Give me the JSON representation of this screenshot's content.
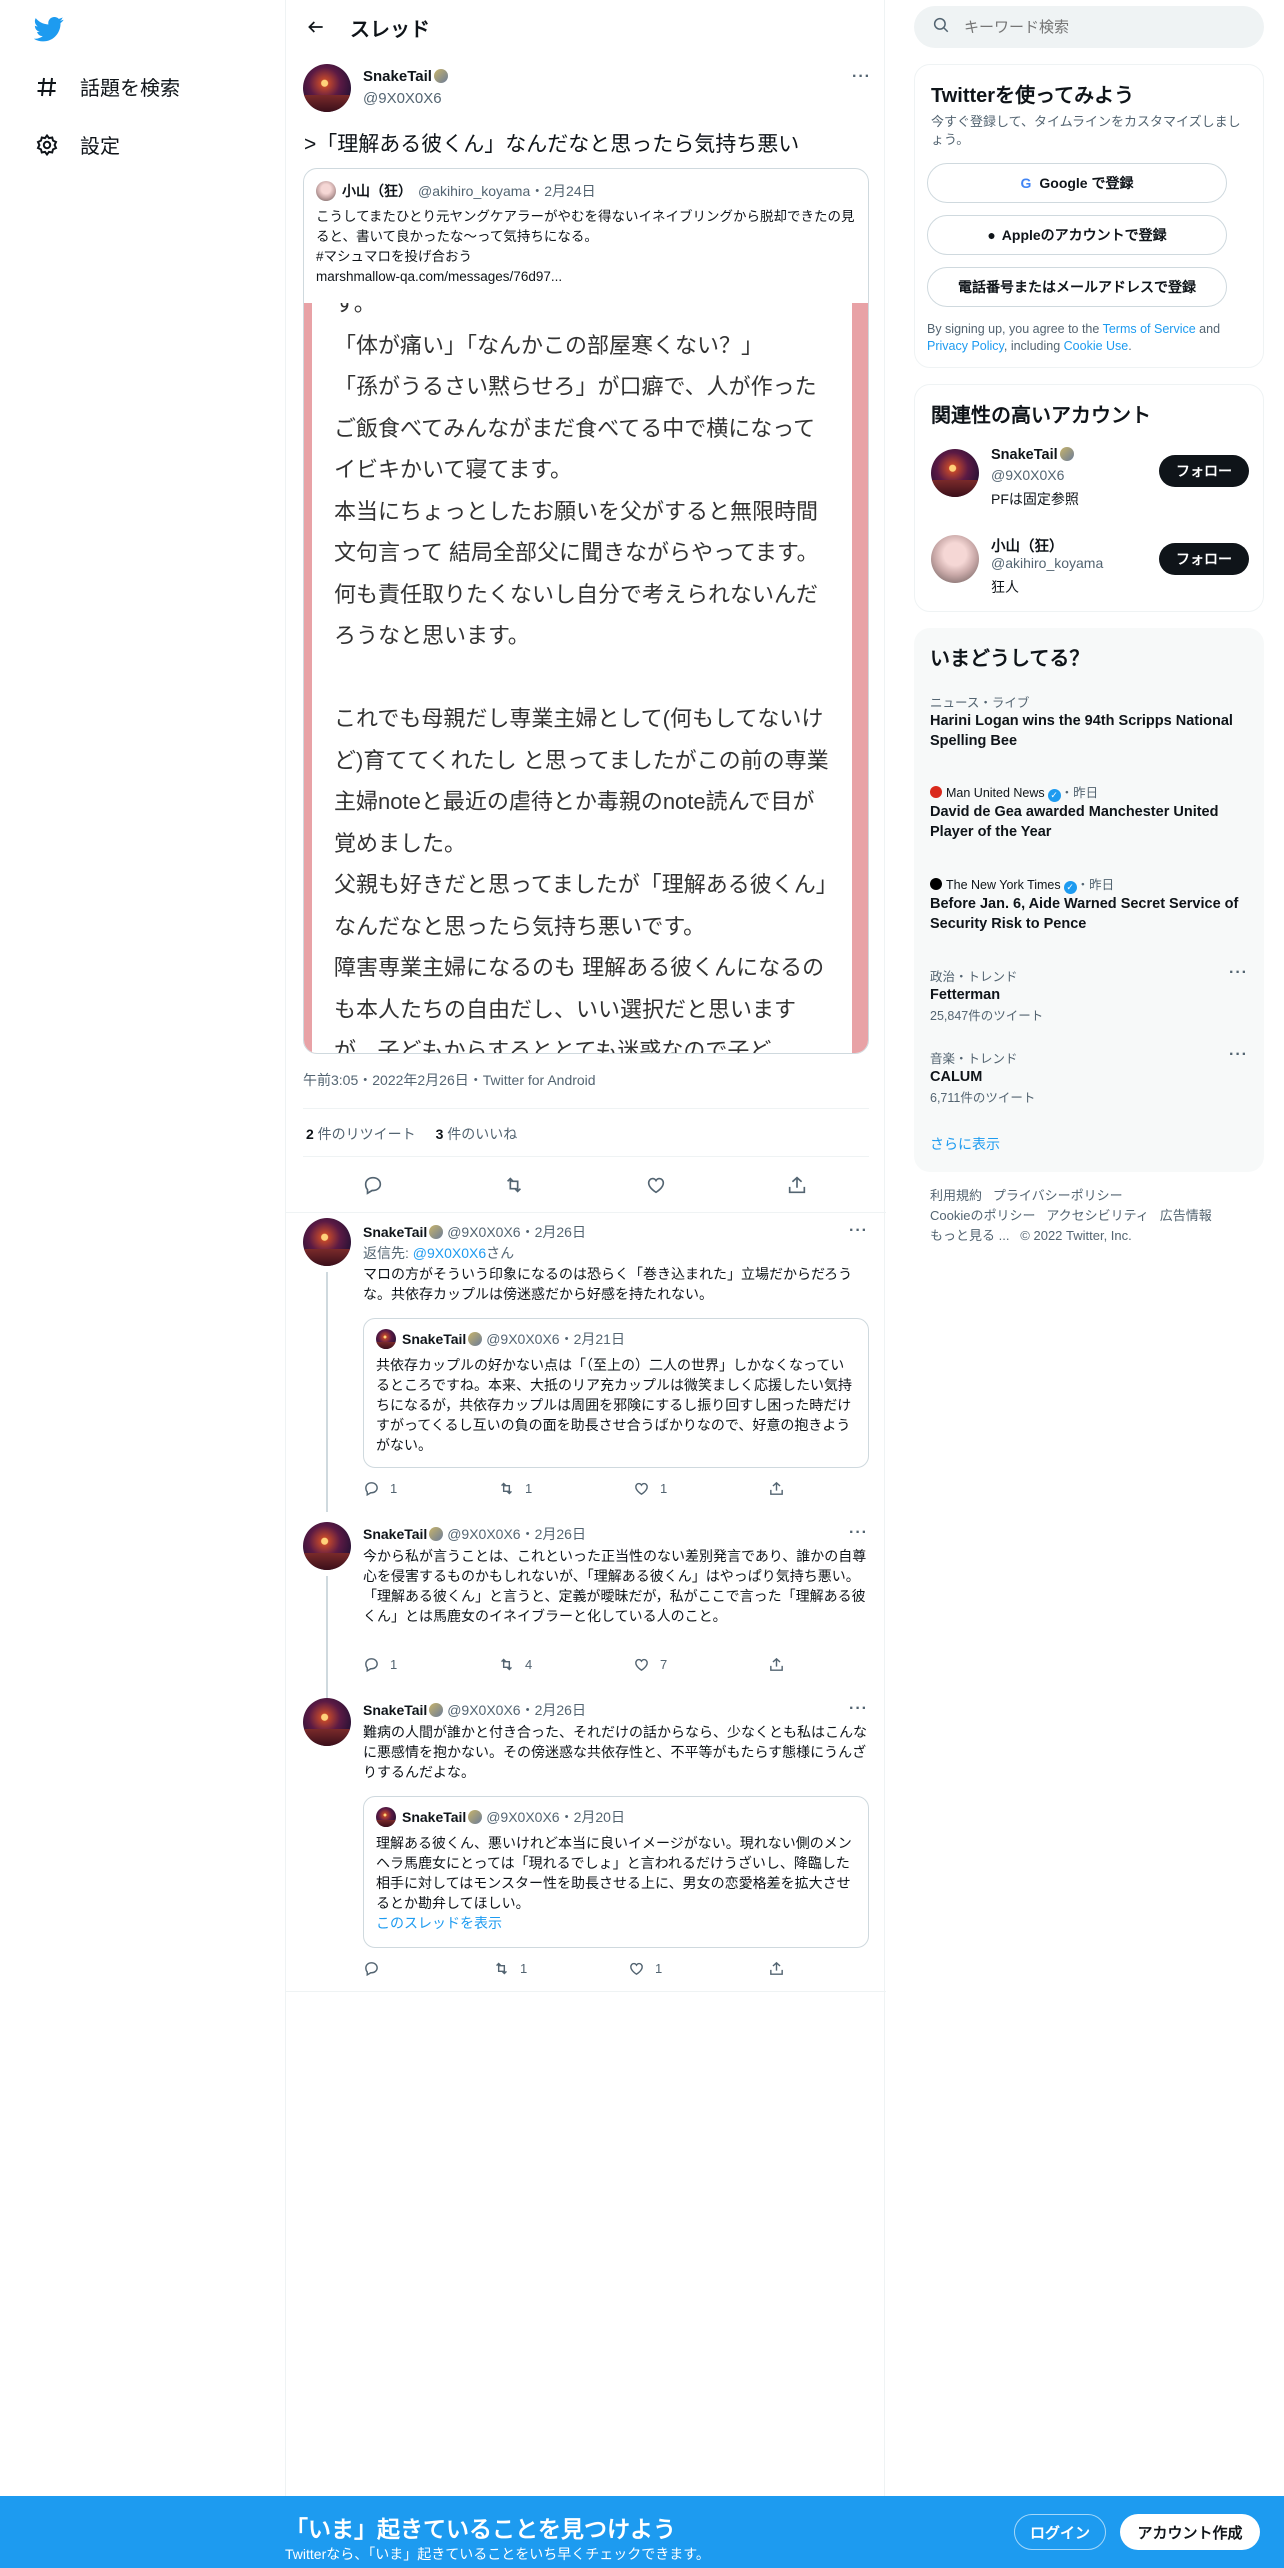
{
  "nav": {
    "explore": "話題を検索",
    "settings": "設定"
  },
  "header": {
    "title": "スレッド"
  },
  "main": {
    "name": "SnakeTail",
    "handle": "@9X0X0X6",
    "text": ">「理解ある彼くん」なんだなと思ったら気持ち悪い",
    "quote": {
      "name": "小山（狂）",
      "handle": "@akihiro_koyama",
      "date": "・2月24日",
      "text": "こうしてまたひとり元ヤングケアラーがやむを得ないイネイブリングから脱却できたの見ると、書いて良かったな～って気持ちになる。",
      "hashtag": "#マシュマロを投げ合おう",
      "link": "marshmallow-qa.com/messages/76d97...",
      "image_text": "す。\n「体が痛い」「なんかこの部屋寒くない？」\n「孫がうるさい黙らせろ」が口癖で、人が作ったご飯食べてみんながまだ食べてる中で横になってイビキかいて寝てます。\n本当にちょっとしたお願いを父がすると無限時間文句言って 結局全部父に聞きながらやってます。何も責任取りたくないし自分で考えられないんだろうなと思います。\n\nこれでも母親だし専業主婦として(何もしてないけど)育ててくれたし と思ってましたがこの前の専業主婦noteと最近の虐待とか毒親のnote読んで目が覚めました。\n父親も好きだと思ってましたが「理解ある彼くん」なんだなと思ったら気持ち悪いです。\n障害専業主婦になるのも 理解ある彼くんになるのも本人たちの自由だし、いい選択だと思いますが、子どもからするととても迷惑なので子ど"
    },
    "meta": "午前3:05・2022年2月26日・Twitter for Android",
    "retweets": "2",
    "retweets_label": " 件のリツイート",
    "likes": "3",
    "likes_label": " 件のいいね"
  },
  "replies": [
    {
      "name": "SnakeTail",
      "handle": "@9X0X0X6",
      "date": "・2月26日",
      "reply_to_label": "返信先: ",
      "reply_to": "@9X0X0X6",
      "reply_to_suffix": "さん",
      "text": "マロの方がそういう印象になるのは恐らく「巻き込まれた」立場だからだろうな。共依存カップルは傍迷惑だから好感を持たれない。",
      "quote": {
        "name": "SnakeTail",
        "handle": "@9X0X0X6",
        "date": "・2月21日",
        "text": "共依存カップルの好かない点は「（至上の）二人の世界」しかなくなっているところですね。本来、大抵のリア充カップルは微笑ましく応援したい気持ちになるが，共依存カップルは周囲を邪険にするし振り回すし困った時だけすがってくるし互いの負の面を助長させ合うばかりなので、好意の抱きようがない。"
      },
      "replies": "1",
      "retweets": "1",
      "likes": "1"
    },
    {
      "name": "SnakeTail",
      "handle": "@9X0X0X6",
      "date": "・2月26日",
      "text": "今から私が言うことは、これといった正当性のない差別発言であり、誰かの自尊心を侵害するものかもしれないが、「理解ある彼くん」はやっぱり気持ち悪い。「理解ある彼くん」と言うと、定義が曖昧だが，私がここで言った「理解ある彼くん」とは馬鹿女のイネイブラーと化している人のこと。",
      "replies": "1",
      "retweets": "4",
      "likes": "7"
    },
    {
      "name": "SnakeTail",
      "handle": "@9X0X0X6",
      "date": "・2月26日",
      "text": "難病の人間が誰かと付き合った、それだけの話からなら、少なくとも私はこんなに悪感情を抱かない。その傍迷惑な共依存性と、不平等がもたらす態様にうんざりするんだよな。",
      "quote": {
        "name": "SnakeTail",
        "handle": "@9X0X0X6",
        "date": "・2月20日",
        "text": "理解ある彼くん、悪いけれど本当に良いイメージがない。現れない側のメンヘラ馬鹿女にとっては「現れるでしょ」と言われるだけうざいし、降臨した相手に対してはモンスター性を助長させる上に、男女の恋愛格差を拡大させるとか勘弁してほしい。",
        "show_thread": "このスレッドを表示"
      },
      "replies": "",
      "retweets": "1",
      "likes": "1"
    }
  ],
  "sidebar": {
    "search_placeholder": "キーワード検索",
    "signup": {
      "title": "Twitterを使ってみよう",
      "desc": "今すぐ登録して、タイムラインをカスタマイズしましょう。",
      "google": "Google で登録",
      "apple": "Appleのアカウントで登録",
      "phone": "電話番号またはメールアドレスで登録",
      "terms_pre": "By signing up, you agree to the ",
      "terms": "Terms of Service",
      "terms_and": " and ",
      "privacy": "Privacy Policy",
      "terms_inc": ", including ",
      "cookie": "Cookie Use",
      "terms_end": "."
    },
    "relevant": {
      "title": "関連性の高いアカウント",
      "follow": "フォロー",
      "accounts": [
        {
          "name": "SnakeTail",
          "handle": "@9X0X0X6",
          "bio": "PFは固定参照"
        },
        {
          "name": "小山（狂）",
          "handle": "@akihiro_koyama",
          "bio": "狂人"
        }
      ]
    },
    "trends": {
      "title": "いまどうしてる？",
      "items": [
        {
          "source": "ニュース・ライブ",
          "title": "Harini Logan wins the 94th Scripps National Spelling Bee"
        },
        {
          "source": "Man United News",
          "time": "・昨日",
          "title": "David de Gea awarded Manchester United Player of the Year"
        },
        {
          "source": "The New York Times",
          "time": "・昨日",
          "title": "Before Jan. 6, Aide Warned Secret Service of Security Risk to Pence"
        },
        {
          "source": "政治・トレンド",
          "title": "Fetterman",
          "count": "25,847件のツイート"
        },
        {
          "source": "音楽・トレンド",
          "title": "CALUM",
          "count": "6,711件のツイート"
        }
      ],
      "more": "さらに表示"
    },
    "footer": {
      "l1": "利用規約",
      "l2": "プライバシーポリシー",
      "l3": "Cookieのポリシー",
      "l4": "アクセシビリティ",
      "l5": "広告情報",
      "l6": "もっと見る ...",
      "copy": "© 2022 Twitter, Inc."
    }
  },
  "bottom": {
    "headline": "「いま」起きていることを見つけよう",
    "sub": "Twitterなら、「いま」起きていることをいち早くチェックできます。",
    "login": "ログイン",
    "signup": "アカウント作成"
  },
  "colors": {
    "accent": "#1d9bf0",
    "text": "#0f1419",
    "muted": "#536471"
  }
}
